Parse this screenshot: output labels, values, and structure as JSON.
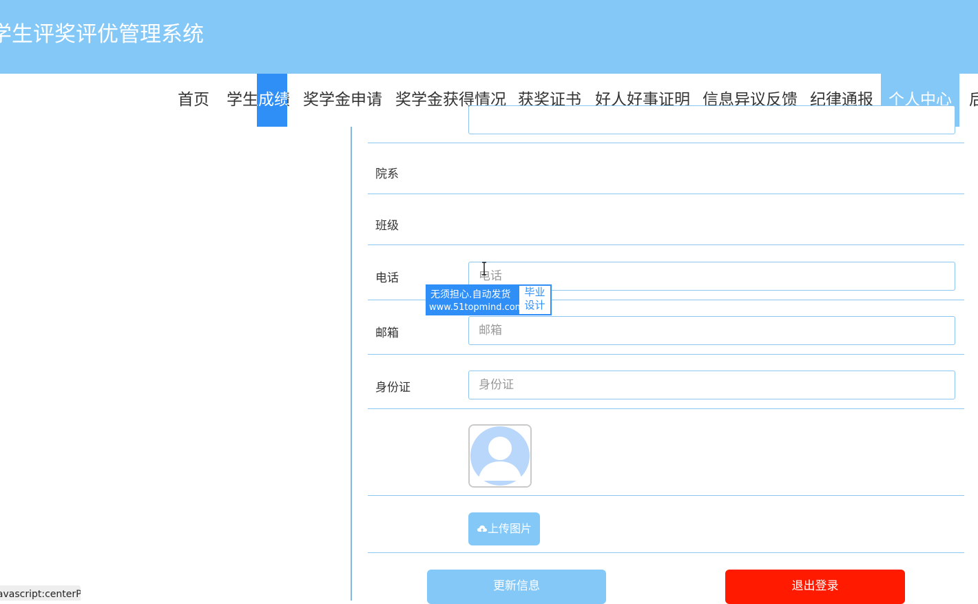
{
  "header": {
    "title": "学生评奖评优管理系统"
  },
  "nav": {
    "items": [
      {
        "label": "首页"
      },
      {
        "label": "学生成绩"
      },
      {
        "label": "奖学金申请"
      },
      {
        "label": "奖学金获得情况"
      },
      {
        "label": "获奖证书"
      },
      {
        "label": "好人好事证明"
      },
      {
        "label": "信息异议反馈"
      },
      {
        "label": "纪律通报"
      },
      {
        "label": "个人中心"
      },
      {
        "label": "后"
      }
    ],
    "active": "个人中心"
  },
  "form": {
    "department_label": "院系",
    "class_label": "班级",
    "phone_label": "电话",
    "phone_placeholder": "电话",
    "email_label": "邮箱",
    "email_placeholder": "邮箱",
    "idcard_label": "身份证",
    "idcard_placeholder": "身份证",
    "upload_label": "上传图片"
  },
  "actions": {
    "update_label": "更新信息",
    "logout_label": "退出登录"
  },
  "status_bar": {
    "text": "javascript:centerPage();"
  },
  "watermark": {
    "line1": "无须担心.自动发货",
    "line2": "www.51topmind.com",
    "badge_line1": "毕业",
    "badge_line2": "设计"
  },
  "colors": {
    "header_bg": "#84c8f8",
    "nav_active_bg": "#84c8f8",
    "highlight_blue": "#2f8ff6",
    "logout_red": "#ff1a00",
    "border": "#8cc6ee"
  },
  "icons": {
    "upload": "cloud-upload-icon",
    "avatar": "user-avatar-icon",
    "cursor": "text-cursor-icon"
  }
}
